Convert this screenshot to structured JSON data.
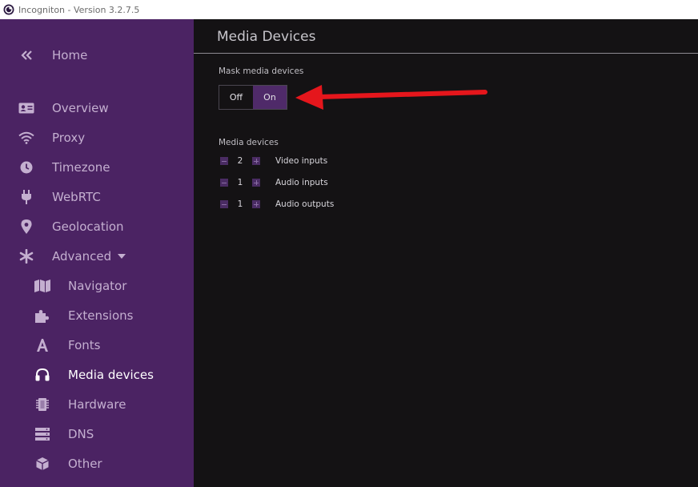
{
  "window": {
    "title": "Incogniton - Version 3.2.7.5"
  },
  "sidebar": {
    "home": {
      "label": "Home",
      "icon": "double-chevron-left-icon"
    },
    "items": [
      {
        "label": "Overview",
        "icon": "id-card-icon"
      },
      {
        "label": "Proxy",
        "icon": "wifi-icon"
      },
      {
        "label": "Timezone",
        "icon": "clock-icon"
      },
      {
        "label": "WebRTC",
        "icon": "plug-icon"
      },
      {
        "label": "Geolocation",
        "icon": "map-pin-icon"
      },
      {
        "label": "Advanced",
        "icon": "asterisk-icon"
      }
    ],
    "sub_items": [
      {
        "label": "Navigator",
        "icon": "map-icon"
      },
      {
        "label": "Extensions",
        "icon": "puzzle-icon"
      },
      {
        "label": "Fonts",
        "icon": "font-icon"
      },
      {
        "label": "Media devices",
        "icon": "headphones-icon",
        "active": true
      },
      {
        "label": "Hardware",
        "icon": "chip-icon"
      },
      {
        "label": "DNS",
        "icon": "server-icon"
      },
      {
        "label": "Other",
        "icon": "box-icon"
      }
    ]
  },
  "main": {
    "title": "Media Devices",
    "mask": {
      "label": "Mask media devices",
      "off_label": "Off",
      "on_label": "On",
      "selected": "On"
    },
    "devices": {
      "label": "Media devices",
      "rows": [
        {
          "count": "2",
          "label": "Video inputs"
        },
        {
          "count": "1",
          "label": "Audio inputs"
        },
        {
          "count": "1",
          "label": "Audio outputs"
        }
      ]
    }
  },
  "colors": {
    "sidebar_bg": "#4b2363",
    "main_bg": "#141214",
    "toggle_selected": "#4f2a69",
    "annotation_arrow": "#e5161c"
  }
}
